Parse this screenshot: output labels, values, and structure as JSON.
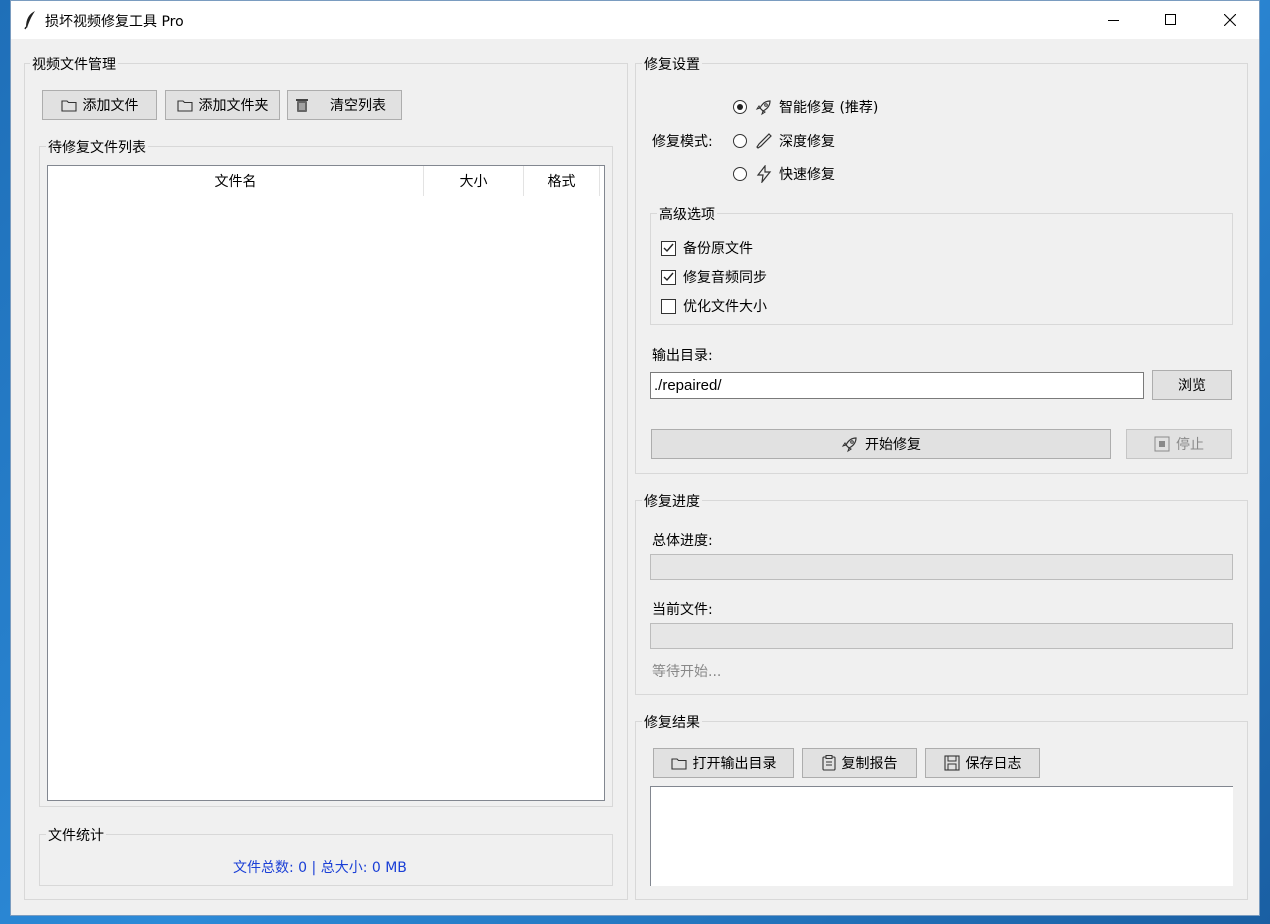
{
  "window": {
    "title": "损坏视频修复工具 Pro",
    "controls": {
      "minimize": "minimize-icon",
      "maximize": "maximize-icon",
      "close": "close-icon"
    }
  },
  "file_manager": {
    "group_title": "视频文件管理",
    "buttons": {
      "add_file": "添加文件",
      "add_folder": "添加文件夹",
      "clear_list": "清空列表"
    },
    "list_group_title": "待修复文件列表",
    "columns": [
      "文件名",
      "大小",
      "格式"
    ],
    "rows": []
  },
  "stats": {
    "group_title": "文件统计",
    "text": "文件总数: 0 | 总大小: 0 MB",
    "color": "#1a3fd6"
  },
  "settings": {
    "group_title": "修复设置",
    "mode_label": "修复模式:",
    "modes": [
      "智能修复 (推荐)",
      "深度修复",
      "快速修复"
    ],
    "selected_mode": 0,
    "advanced_title": "高级选项",
    "options": [
      {
        "label": "备份原文件",
        "checked": true
      },
      {
        "label": "修复音频同步",
        "checked": true
      },
      {
        "label": "优化文件大小",
        "checked": false
      }
    ],
    "output_label": "输出目录:",
    "output_value": "./repaired/",
    "browse": "浏览",
    "start": "开始修复",
    "stop": "停止"
  },
  "progress": {
    "group_title": "修复进度",
    "overall_label": "总体进度:",
    "overall_value": 0,
    "current_label": "当前文件:",
    "current_value": 0,
    "status": "等待开始..."
  },
  "results": {
    "group_title": "修复结果",
    "open_output": "打开输出目录",
    "copy_report": "复制报告",
    "save_log": "保存日志",
    "log_text": ""
  }
}
